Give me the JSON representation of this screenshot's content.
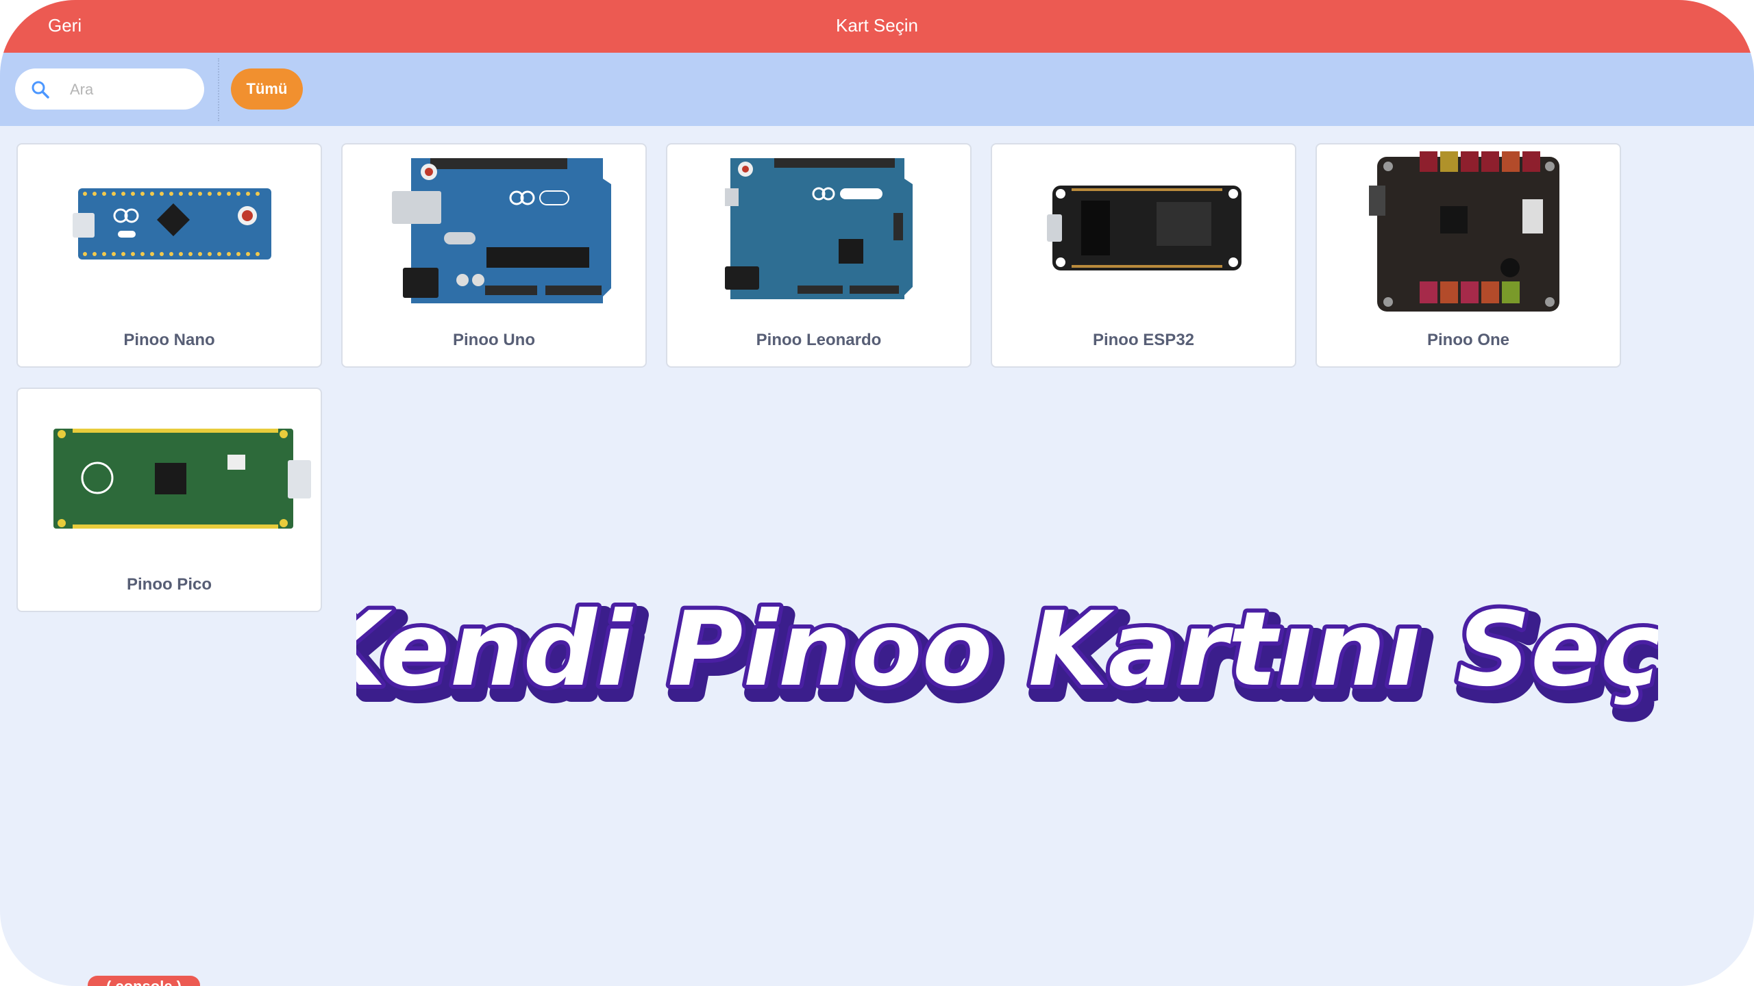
{
  "header": {
    "back_label": "Geri",
    "title": "Kart Seçin"
  },
  "filter": {
    "search_placeholder": "Ara",
    "search_value": "",
    "tag_label": "Tümü"
  },
  "boards": [
    {
      "name": "Pinoo Nano"
    },
    {
      "name": "Pinoo Uno"
    },
    {
      "name": "Pinoo Leonardo"
    },
    {
      "name": "Pinoo ESP32"
    },
    {
      "name": "Pinoo One"
    },
    {
      "name": "Pinoo Pico"
    }
  ],
  "promo": {
    "headline": "Kendi Pinoo Kartını Seç!"
  },
  "console_badge": "( console )",
  "colors": {
    "header": "#ec5a52",
    "filter_bar": "#b8cff7",
    "background": "#e9effb",
    "tag": "#f1902f",
    "promo_fill": "#ffffff",
    "promo_stroke": "#3b1e8c",
    "promo_outline": "#f2f200"
  }
}
